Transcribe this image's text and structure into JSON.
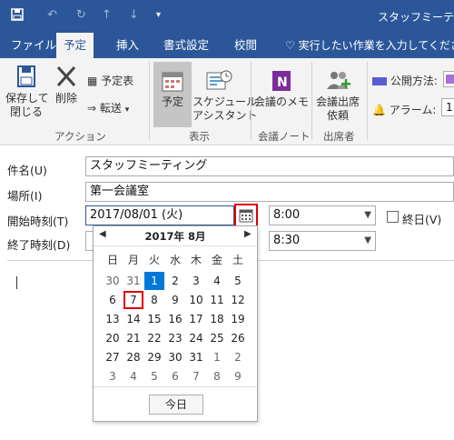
{
  "window": {
    "title": "スタッフミーテ"
  },
  "ribbon_tabs": [
    "ファイル",
    "予定",
    "挿入",
    "書式設定",
    "校閲",
    "実行したい作業を入力してください"
  ],
  "ribbon": {
    "save_close": [
      "保存して",
      "閉じる"
    ],
    "delete": "削除",
    "calendar_view": "予定表",
    "forward": "転送",
    "group_action": "アクション",
    "appointment": "予定",
    "scheduling": [
      "スケジュール",
      "アシスタント"
    ],
    "group_show": "表示",
    "meeting_notes": "会議のメモ",
    "group_notes": "会議ノート",
    "invite": [
      "会議出席",
      "依頼"
    ],
    "group_attendees": "出席者",
    "public_method": "公開方法:",
    "alarm": "アラーム:",
    "alarm_value": "1:"
  },
  "form": {
    "subject_label": "件名(U)",
    "subject_value": "スタッフミーティング",
    "location_label": "場所(I)",
    "location_value": "第一会議室",
    "start_label": "開始時刻(T)",
    "start_date": "2017/08/01 (火)",
    "start_time": "8:00",
    "allday_label": "終日(V)",
    "end_label": "終了時刻(D)",
    "end_time": "8:30"
  },
  "calendar": {
    "month_title": "2017年 8月",
    "weekdays": [
      "日",
      "月",
      "火",
      "水",
      "木",
      "金",
      "土"
    ],
    "weeks": [
      [
        "30",
        "31",
        "1",
        "2",
        "3",
        "4",
        "5"
      ],
      [
        "6",
        "7",
        "8",
        "9",
        "10",
        "11",
        "12"
      ],
      [
        "13",
        "14",
        "15",
        "16",
        "17",
        "18",
        "19"
      ],
      [
        "20",
        "21",
        "22",
        "23",
        "24",
        "25",
        "26"
      ],
      [
        "27",
        "28",
        "29",
        "30",
        "31",
        "1",
        "2"
      ],
      [
        "3",
        "4",
        "5",
        "6",
        "7",
        "8",
        "9"
      ]
    ],
    "selected_day": "1",
    "highlighted_day": "7",
    "today_label": "今日"
  },
  "colors": {
    "accent": "#2b579a",
    "selection": "#0078d7",
    "highlight": "#e00000"
  }
}
